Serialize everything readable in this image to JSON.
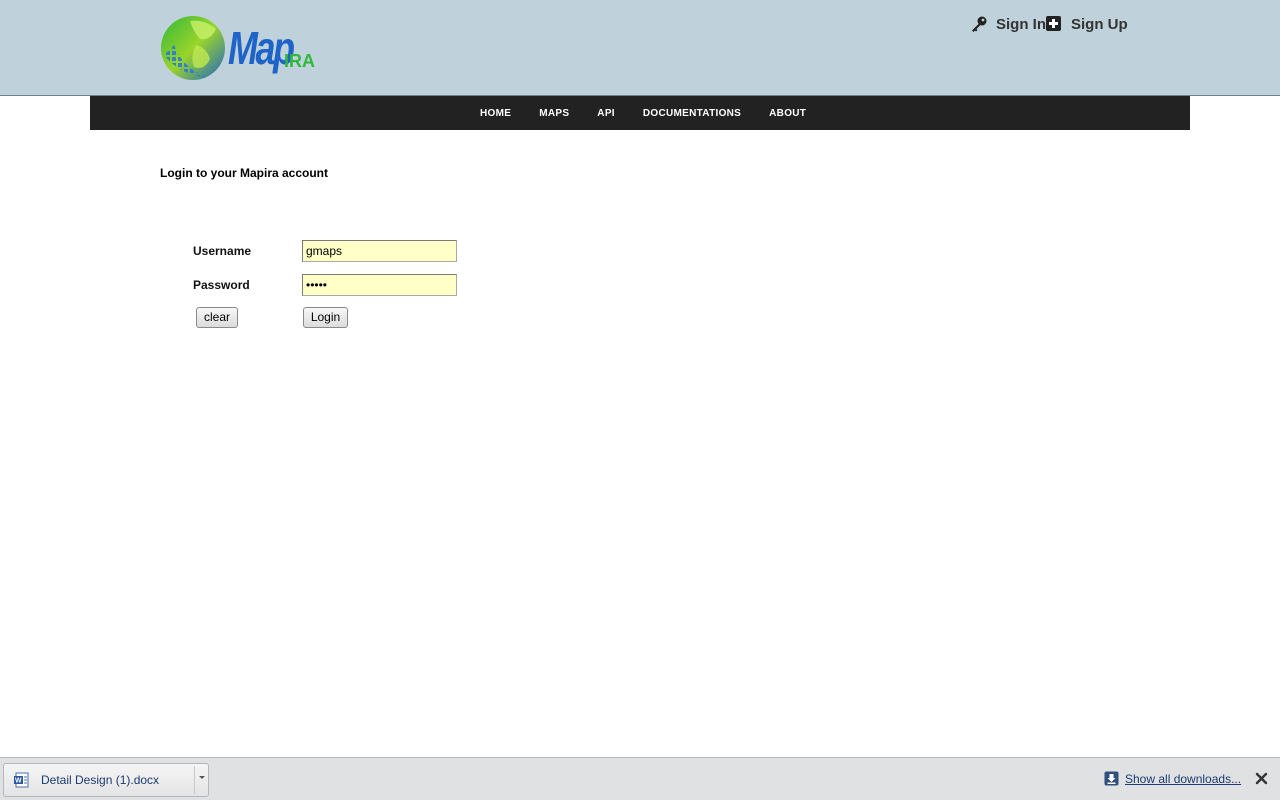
{
  "header": {
    "logo": {
      "main_text": "Map",
      "sub_text": "IRA",
      "globe_icon": "globe-logo-icon"
    },
    "auth": {
      "sign_in": {
        "label": "Sign In",
        "icon": "key-icon"
      },
      "sign_up": {
        "label": "Sign Up",
        "icon": "plus-icon"
      }
    }
  },
  "nav": {
    "items": [
      {
        "label": "HOME"
      },
      {
        "label": "MAPS"
      },
      {
        "label": "API"
      },
      {
        "label": "DOCUMENTATIONS"
      },
      {
        "label": "ABOUT"
      }
    ]
  },
  "login": {
    "title": "Login to your Mapira account",
    "username_label": "Username",
    "username_value": "gmaps",
    "password_label": "Password",
    "password_value": "•••••",
    "clear_label": "clear",
    "login_label": "Login"
  },
  "download_bar": {
    "item": {
      "file_name": "Detail Design (1).docx",
      "icon": "word-document-icon"
    },
    "show_all_label": "Show all downloads...",
    "colors": {
      "link": "#1c3b73"
    }
  },
  "colors": {
    "header_bg": "#bfd1da",
    "navbar_bg": "#222222",
    "input_bg": "#ffffc8",
    "logo_blue": "#1e63c8",
    "logo_green": "#2fb83a"
  }
}
